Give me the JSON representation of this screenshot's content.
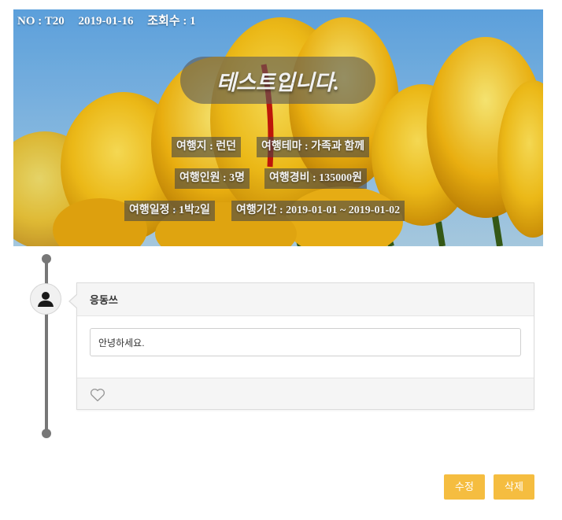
{
  "post": {
    "no": "NO : T20",
    "date": "2019-01-16",
    "views": "조회수 : 1",
    "title": "테스트입니다.",
    "destination": "여행지 : 런던",
    "theme": "여행테마 : 가족과 함께",
    "people": "여행인원 : 3명",
    "cost": "여행경비 : 135000원",
    "schedule": "여행일정 : 1박2일",
    "period": "여행기간 : 2019-01-01 ~ 2019-01-02"
  },
  "comment": {
    "author": "응동쓰",
    "text": "안녕하세요."
  },
  "icons": {
    "avatar": "user-icon",
    "like": "heart-icon"
  },
  "actions": {
    "edit": "수정",
    "delete": "삭제"
  },
  "colors": {
    "button": "#f5bd40",
    "timeline": "#777777"
  }
}
